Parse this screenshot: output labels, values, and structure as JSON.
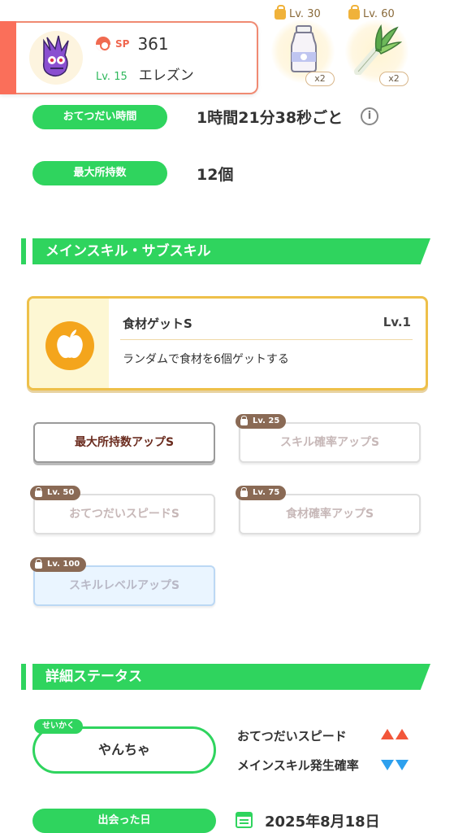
{
  "ingredients": [
    {
      "unlock_level": "Lv. 30",
      "count": "x2",
      "icon": "milk-bottle-icon"
    },
    {
      "unlock_level": "Lv. 60",
      "count": "x2",
      "icon": "leek-icon"
    }
  ],
  "pokemon": {
    "sp_label": "SP",
    "sp_value": "361",
    "level": "Lv. 15",
    "name": "エレズン",
    "avatar_icon": "toxel-avatar-icon"
  },
  "info": {
    "help_time_label": "おてつだい時間",
    "help_time_value": "1時間21分38秒ごと",
    "max_carry_label": "最大所持数",
    "max_carry_value": "12個"
  },
  "skills_section": {
    "title": "メインスキル・サブスキル",
    "main_skill": {
      "name": "食材ゲットS",
      "level": "Lv.1",
      "description": "ランダムで食材を6個ゲットする",
      "icon": "apple-icon"
    },
    "sub_skills": [
      {
        "label": "最大所持数アップS",
        "unlock": "",
        "state": "active"
      },
      {
        "label": "スキル確率アップS",
        "unlock": "Lv. 25",
        "state": "locked"
      },
      {
        "label": "おてつだいスピードS",
        "unlock": "Lv. 50",
        "state": "locked"
      },
      {
        "label": "食材確率アップS",
        "unlock": "Lv. 75",
        "state": "locked"
      },
      {
        "label": "スキルレベルアップS",
        "unlock": "Lv. 100",
        "state": "locked-blue"
      }
    ]
  },
  "details_section": {
    "title": "詳細ステータス",
    "nature_tag": "せいかく",
    "nature_value": "やんちゃ",
    "stat_up_label": "おてつだいスピード",
    "stat_down_label": "メインスキル発生確率",
    "stat_up_indicator": "up-triangles",
    "stat_down_indicator": "down-triangles",
    "met_date_label": "出会った日",
    "met_date_value": "2025年8月18日"
  },
  "colors": {
    "accent_green": "#2fd45e",
    "header_red": "#fa6f5a",
    "skill_gold": "#eec04a",
    "up_red": "#f2563a",
    "down_blue": "#2da0ee"
  }
}
